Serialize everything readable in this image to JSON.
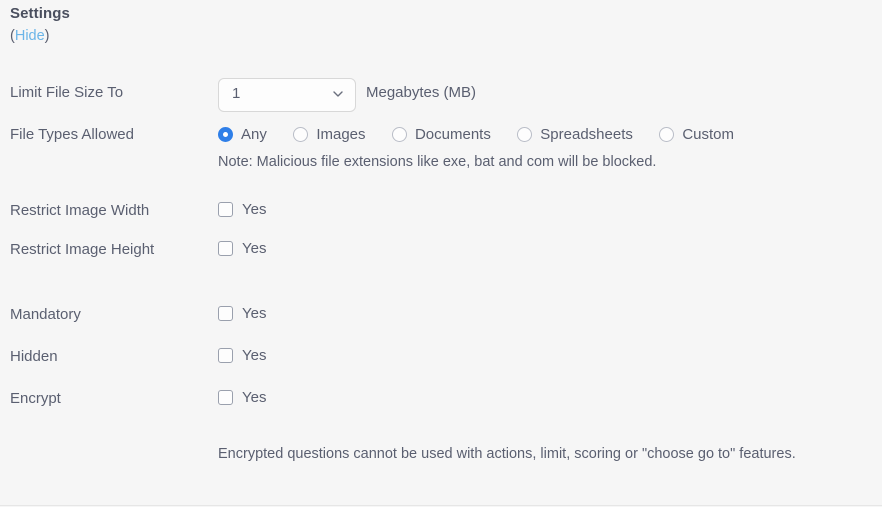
{
  "panel": {
    "heading": "Settings",
    "hide_open_paren": "(",
    "hide_link": "Hide",
    "hide_close_paren": ")"
  },
  "colors": {
    "background": "#f6f6f6",
    "text": "#5a5f70",
    "heading": "#4a4f5e",
    "link": "#6bb5e8",
    "radio_selected": "#2f7fe8",
    "control_border": "#d8d8d8",
    "checkbox_border": "#9aa0ad"
  },
  "fields": {
    "limit_file_size": {
      "label": "Limit File Size To",
      "selected_value": "1",
      "options": [
        "1"
      ],
      "unit": "Megabytes (MB)"
    },
    "file_types_allowed": {
      "label": "File Types Allowed",
      "options": [
        {
          "label": "Any",
          "selected": true
        },
        {
          "label": "Images",
          "selected": false
        },
        {
          "label": "Documents",
          "selected": false
        },
        {
          "label": "Spreadsheets",
          "selected": false
        },
        {
          "label": "Custom",
          "selected": false
        }
      ],
      "note": "Note: Malicious file extensions like exe, bat and com will be blocked."
    },
    "restrict_image_width": {
      "label": "Restrict Image Width",
      "checkbox_label": "Yes",
      "checked": false
    },
    "restrict_image_height": {
      "label": "Restrict Image Height",
      "checkbox_label": "Yes",
      "checked": false
    },
    "mandatory": {
      "label": "Mandatory",
      "checkbox_label": "Yes",
      "checked": false
    },
    "hidden": {
      "label": "Hidden",
      "checkbox_label": "Yes",
      "checked": false
    },
    "encrypt": {
      "label": "Encrypt",
      "checkbox_label": "Yes",
      "checked": false,
      "helptext": "Encrypted questions cannot be used with actions, limit, scoring or \"choose go to\" features."
    }
  }
}
